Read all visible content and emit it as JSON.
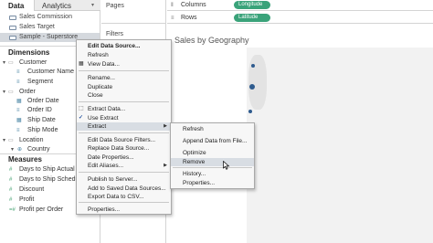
{
  "tabs": {
    "data": "Data",
    "analytics": "Analytics"
  },
  "data_sources": [
    {
      "label": "Sales Commission"
    },
    {
      "label": "Sales Target"
    },
    {
      "label": "Sample - Superstore"
    }
  ],
  "dimensions": {
    "title": "Dimensions",
    "items": [
      {
        "label": "Customer",
        "kind": "folder"
      },
      {
        "label": "Customer Name",
        "kind": "dim-abc"
      },
      {
        "label": "Segment",
        "kind": "dim-abc"
      },
      {
        "label": "Order",
        "kind": "folder"
      },
      {
        "label": "Order Date",
        "kind": "dim-date"
      },
      {
        "label": "Order ID",
        "kind": "dim-abc"
      },
      {
        "label": "Ship Date",
        "kind": "dim-date"
      },
      {
        "label": "Ship Mode",
        "kind": "dim-abc"
      },
      {
        "label": "Location",
        "kind": "folder"
      },
      {
        "label": "Country",
        "kind": "dim-geo"
      }
    ]
  },
  "measures": {
    "title": "Measures",
    "items": [
      {
        "label": "Days to Ship Actual"
      },
      {
        "label": "Days to Ship Schedu..."
      },
      {
        "label": "Discount"
      },
      {
        "label": "Profit"
      },
      {
        "label": "Profit per Order"
      }
    ]
  },
  "shelves": {
    "pages": "Pages",
    "filters": "Filters",
    "columns": {
      "label": "Columns",
      "pill": "Longitude"
    },
    "rows": {
      "label": "Rows",
      "pill": "Latitude"
    }
  },
  "view": {
    "title": "Sales by Geography"
  },
  "context_menu": {
    "items": [
      {
        "label": "Edit Data Source...",
        "bold": true,
        "icon": ""
      },
      {
        "label": "Refresh",
        "icon": ""
      },
      {
        "label": "View Data...",
        "icon": "grid-icon"
      },
      {
        "label": "Rename...",
        "icon": ""
      },
      {
        "label": "Duplicate",
        "icon": ""
      },
      {
        "label": "Close",
        "icon": ""
      },
      {
        "label": "Extract Data...",
        "icon": "extract-icon"
      },
      {
        "label": "Use Extract",
        "icon": "check-icon"
      },
      {
        "label": "Extract",
        "icon": "",
        "submenu": true,
        "highlighted": true
      },
      {
        "label": "Edit Data Source Filters...",
        "icon": ""
      },
      {
        "label": "Replace Data Source...",
        "icon": ""
      },
      {
        "label": "Date Properties...",
        "icon": ""
      },
      {
        "label": "Edit Aliases...",
        "icon": "",
        "submenu": true
      },
      {
        "label": "Publish to Server...",
        "icon": ""
      },
      {
        "label": "Add to Saved Data Sources...",
        "icon": ""
      },
      {
        "label": "Export Data to CSV...",
        "icon": ""
      },
      {
        "label": "Properties...",
        "icon": ""
      }
    ]
  },
  "submenu": {
    "items": [
      {
        "label": "Refresh"
      },
      {
        "label": "Append Data from File..."
      },
      {
        "label": "Optimize"
      },
      {
        "label": "Remove",
        "highlighted": true
      },
      {
        "label": "History..."
      },
      {
        "label": "Properties..."
      }
    ]
  },
  "colors": {
    "pill": "#3aa37a",
    "highlight": "#d8dde3",
    "map_dot": "#2f5b8e"
  }
}
